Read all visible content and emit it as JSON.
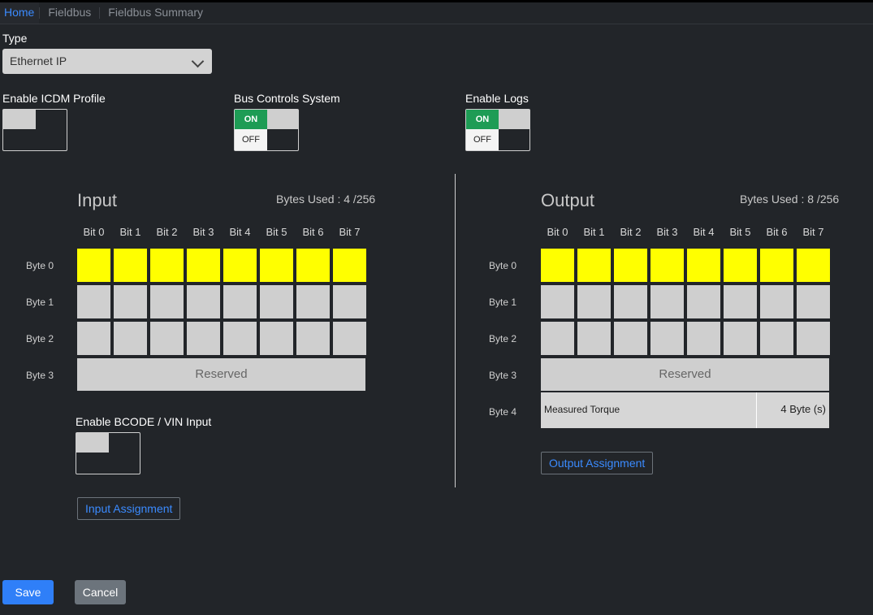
{
  "breadcrumb": {
    "items": [
      "Home",
      "Fieldbus",
      "Fieldbus Summary"
    ]
  },
  "type": {
    "label": "Type",
    "selected": "Ethernet IP"
  },
  "toggles": {
    "icdm": {
      "label": "Enable ICDM Profile"
    },
    "bus_controls": {
      "label": "Bus Controls System",
      "on": "ON",
      "off": "OFF"
    },
    "enable_logs": {
      "label": "Enable Logs",
      "on": "ON",
      "off": "OFF"
    },
    "bcode": {
      "label": "Enable BCODE / VIN Input"
    }
  },
  "bits": [
    "Bit 0",
    "Bit 1",
    "Bit 2",
    "Bit 3",
    "Bit 4",
    "Bit 5",
    "Bit 6",
    "Bit 7"
  ],
  "input": {
    "title": "Input",
    "bytes_used": "Bytes Used : 4 /256",
    "bytes": [
      "Byte 0",
      "Byte 1",
      "Byte 2",
      "Byte 3"
    ],
    "reserved": "Reserved",
    "assign_button": "Input Assignment"
  },
  "output": {
    "title": "Output",
    "bytes_used": "Bytes Used : 8 /256",
    "bytes": [
      "Byte 0",
      "Byte 1",
      "Byte 2",
      "Byte 3",
      "Byte 4"
    ],
    "reserved": "Reserved",
    "torque_name": "Measured Torque",
    "torque_size": "4 Byte (s)",
    "assign_button": "Output Assignment"
  },
  "actions": {
    "save": "Save",
    "cancel": "Cancel"
  },
  "colors": {
    "used_bit": "#ffff00",
    "free_bit": "#cfcfcf",
    "on": "#1e9c55",
    "accent": "#3b8bff"
  }
}
